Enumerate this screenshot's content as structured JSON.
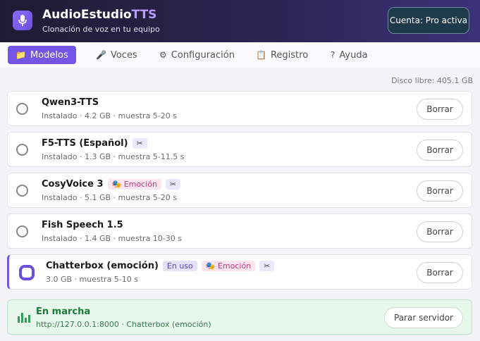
{
  "app": {
    "title_main": "AudioEstudio",
    "title_accent": "TTS",
    "subtitle": "Clonación de voz en tu equipo",
    "account_badge": "Cuenta: Pro activa"
  },
  "tabs": [
    {
      "label": "Modelos",
      "icon": "folder-icon",
      "active": true
    },
    {
      "label": "Voces",
      "icon": "microphone-icon",
      "active": false
    },
    {
      "label": "Configuración",
      "icon": "gear-icon",
      "active": false
    },
    {
      "label": "Registro",
      "icon": "clipboard-icon",
      "active": false
    },
    {
      "label": "Ayuda",
      "icon": "question-icon",
      "active": false
    }
  ],
  "disk_free": "Disco libre: 405.1 GB",
  "models": [
    {
      "name": "Qwen3-TTS",
      "meta": "Instalado · 4.2 GB · muestra 5-20 s",
      "delete_label": "Borrar"
    },
    {
      "name": "F5-TTS (Español)",
      "cut_tag": "✂",
      "meta": "Instalado · 1.3 GB · muestra 5-11.5 s",
      "delete_label": "Borrar"
    },
    {
      "name": "CosyVoice 3",
      "emotion_tag": "Emoción",
      "cut_tag": "✂",
      "meta": "Instalado · 5.1 GB · muestra 5-20 s",
      "delete_label": "Borrar"
    },
    {
      "name": "Fish Speech 1.5",
      "meta": "Instalado · 1.4 GB · muestra 10-30 s",
      "delete_label": "Borrar"
    },
    {
      "name": "Chatterbox (emoción)",
      "in_use_tag": "En uso",
      "emotion_tag": "Emoción",
      "cut_tag": "✂",
      "meta": "3.0 GB · muestra 5-10 s",
      "delete_label": "Borrar",
      "selected": true
    }
  ],
  "server": {
    "title": "En marcha",
    "detail": "http://127.0.0.1:8000 · Chatterbox (emoción)",
    "stop_label": "Parar servidor",
    "status_color": "#2f9d57"
  },
  "colors": {
    "accent": "#7356e8",
    "emotion": "#c2387a",
    "header_bg": "#2a2450"
  }
}
